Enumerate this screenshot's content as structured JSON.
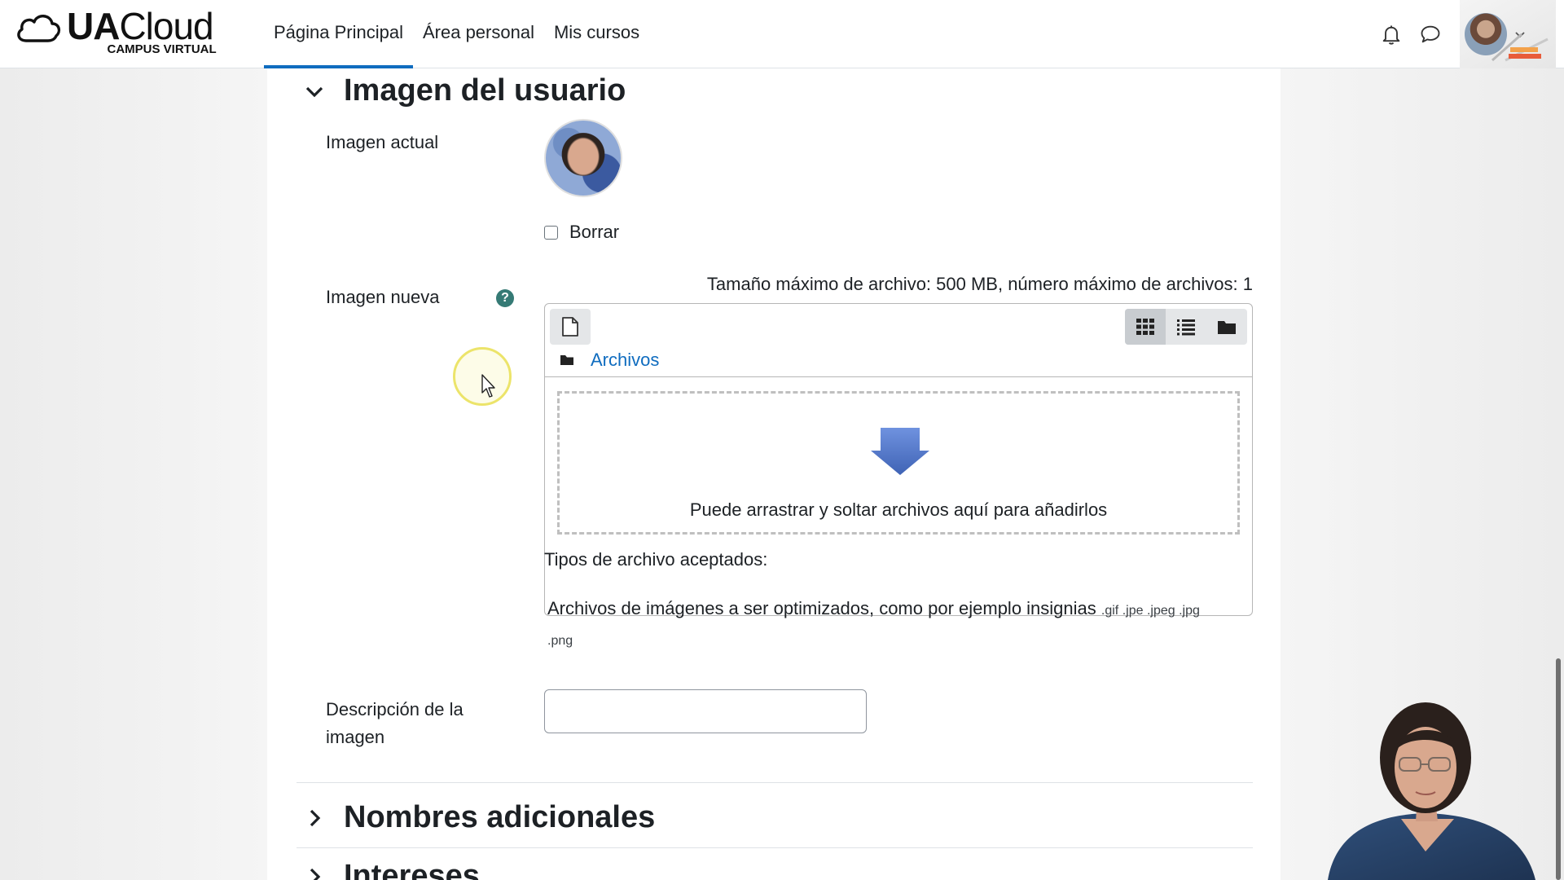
{
  "navbar": {
    "logo": {
      "name_bold": "UA",
      "name_regular": "Cloud",
      "subtitle": "CAMPUS VIRTUAL"
    },
    "links": [
      {
        "label": "Página Principal",
        "active": true
      },
      {
        "label": "Área personal",
        "active": false
      },
      {
        "label": "Mis cursos",
        "active": false
      }
    ],
    "icons": [
      "bell-icon",
      "chat-icon"
    ]
  },
  "user_image_section": {
    "title": "Imagen del usuario",
    "expanded": true,
    "current_image_label": "Imagen actual",
    "delete_checkbox": {
      "label": "Borrar",
      "checked": false
    },
    "new_image_label": "Imagen nueva",
    "max_size_text": "Tamaño máximo de archivo: 500 MB, número máximo de archivos: 1",
    "filepicker": {
      "path_label": "Archivos",
      "drop_text": "Puede arrastrar y soltar archivos aquí para añadirlos",
      "view_active": "icons"
    },
    "accepted_types_title": "Tipos de archivo aceptados:",
    "accepted_types_desc": "Archivos de imágenes a ser optimizados, como por ejemplo insignias",
    "accepted_types_ext_1": ".gif .jpe .jpeg .jpg",
    "accepted_types_ext_2": ".png",
    "description_label": "Descripción de la imagen",
    "description_value": ""
  },
  "collapsed_sections": [
    {
      "title": "Nombres adicionales"
    },
    {
      "title": "Intereses"
    }
  ],
  "colors": {
    "accent": "#0f6cbf",
    "help_icon": "#357a75",
    "drop_arrow": "#5b7fd1"
  }
}
